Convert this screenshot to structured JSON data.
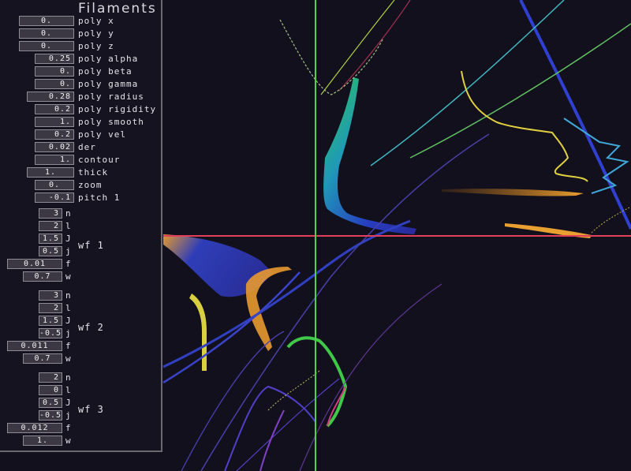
{
  "panel": {
    "title": "Filaments",
    "params": [
      {
        "label": "poly x",
        "value": "0."
      },
      {
        "label": "poly y",
        "value": "0."
      },
      {
        "label": "poly z",
        "value": "0."
      },
      {
        "label": "poly alpha",
        "value": "0.25"
      },
      {
        "label": "poly beta",
        "value": "0."
      },
      {
        "label": "poly gamma",
        "value": "0."
      },
      {
        "label": "poly radius",
        "value": "0.28"
      },
      {
        "label": "poly rigidity",
        "value": "0.2"
      },
      {
        "label": "poly smooth",
        "value": "1."
      },
      {
        "label": "poly vel",
        "value": "0.2"
      },
      {
        "label": "der",
        "value": "0.02"
      },
      {
        "label": "contour",
        "value": "1."
      },
      {
        "label": "thick",
        "value": "1."
      },
      {
        "label": "zoom",
        "value": "0."
      },
      {
        "label": "pitch 1",
        "value": "-0.1"
      }
    ],
    "wavefunctions": [
      {
        "label": "wf 1",
        "fields": [
          {
            "label": "n",
            "value": "3"
          },
          {
            "label": "l",
            "value": "2"
          },
          {
            "label": "J",
            "value": "1.5"
          },
          {
            "label": "j",
            "value": "0.5"
          },
          {
            "label": "f",
            "value": "0.01"
          },
          {
            "label": "w",
            "value": "0.7"
          }
        ]
      },
      {
        "label": "wf 2",
        "fields": [
          {
            "label": "n",
            "value": "3"
          },
          {
            "label": "l",
            "value": "2"
          },
          {
            "label": "J",
            "value": "1.5"
          },
          {
            "label": "j",
            "value": "-0.5"
          },
          {
            "label": "f",
            "value": "0.011"
          },
          {
            "label": "w",
            "value": "0.7"
          }
        ]
      },
      {
        "label": "wf 3",
        "fields": [
          {
            "label": "n",
            "value": "2"
          },
          {
            "label": "l",
            "value": "0"
          },
          {
            "label": "J",
            "value": "0.5"
          },
          {
            "label": "j",
            "value": "-0.5"
          },
          {
            "label": "f",
            "value": "0.012"
          },
          {
            "label": "w",
            "value": "1."
          }
        ]
      }
    ]
  },
  "colors": {
    "background": "#13101e",
    "crosshair_horizontal": "#e0405a",
    "crosshair_vertical": "#4fd24a",
    "panel_border": "#6a6870"
  }
}
